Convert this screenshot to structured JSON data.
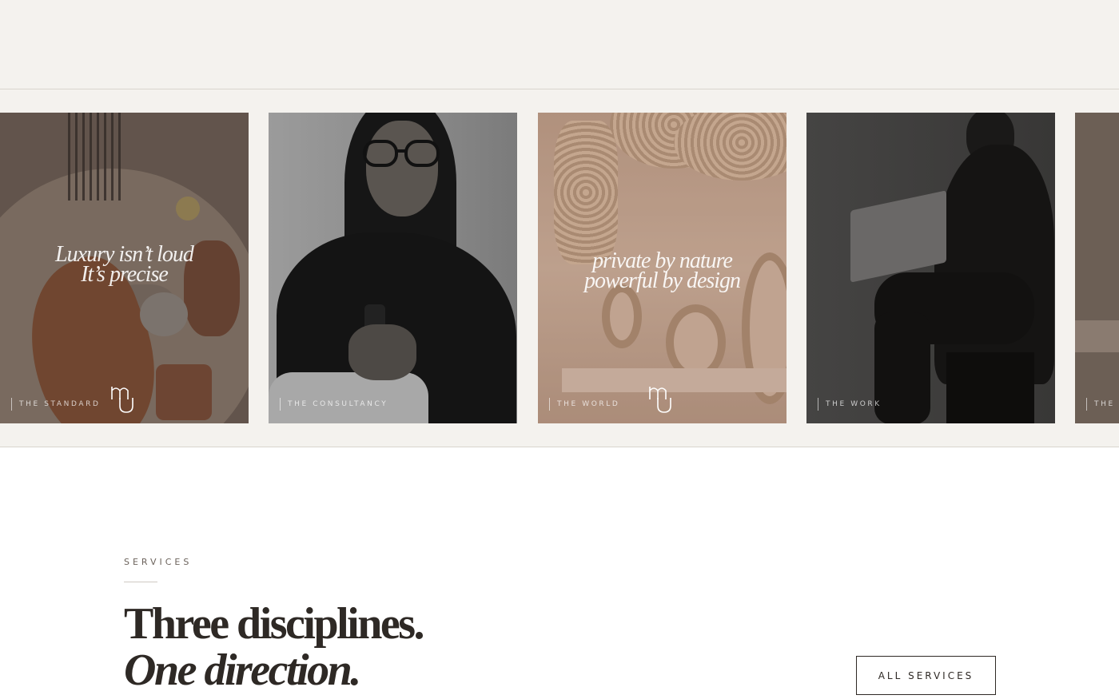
{
  "gallery": {
    "cards": [
      {
        "caption": "THE STANDARD",
        "quote_line1": "Luxury isn’t loud",
        "quote_line2": "It’s precise"
      },
      {
        "caption": "THE CONSULTANCY"
      },
      {
        "caption": "THE WORLD",
        "quote_line1": "private by nature",
        "quote_line2": "powerful by design"
      },
      {
        "caption": "THE WORK"
      },
      {
        "caption": "THE"
      }
    ]
  },
  "services": {
    "eyebrow": "SERVICES",
    "headline_line1": "Three disciplines.",
    "headline_line2": "One direction.",
    "cta_label": "ALL SERVICES"
  },
  "colors": {
    "background": "#ffffff",
    "band": "#f4f2ee",
    "ink": "#2e2925"
  }
}
